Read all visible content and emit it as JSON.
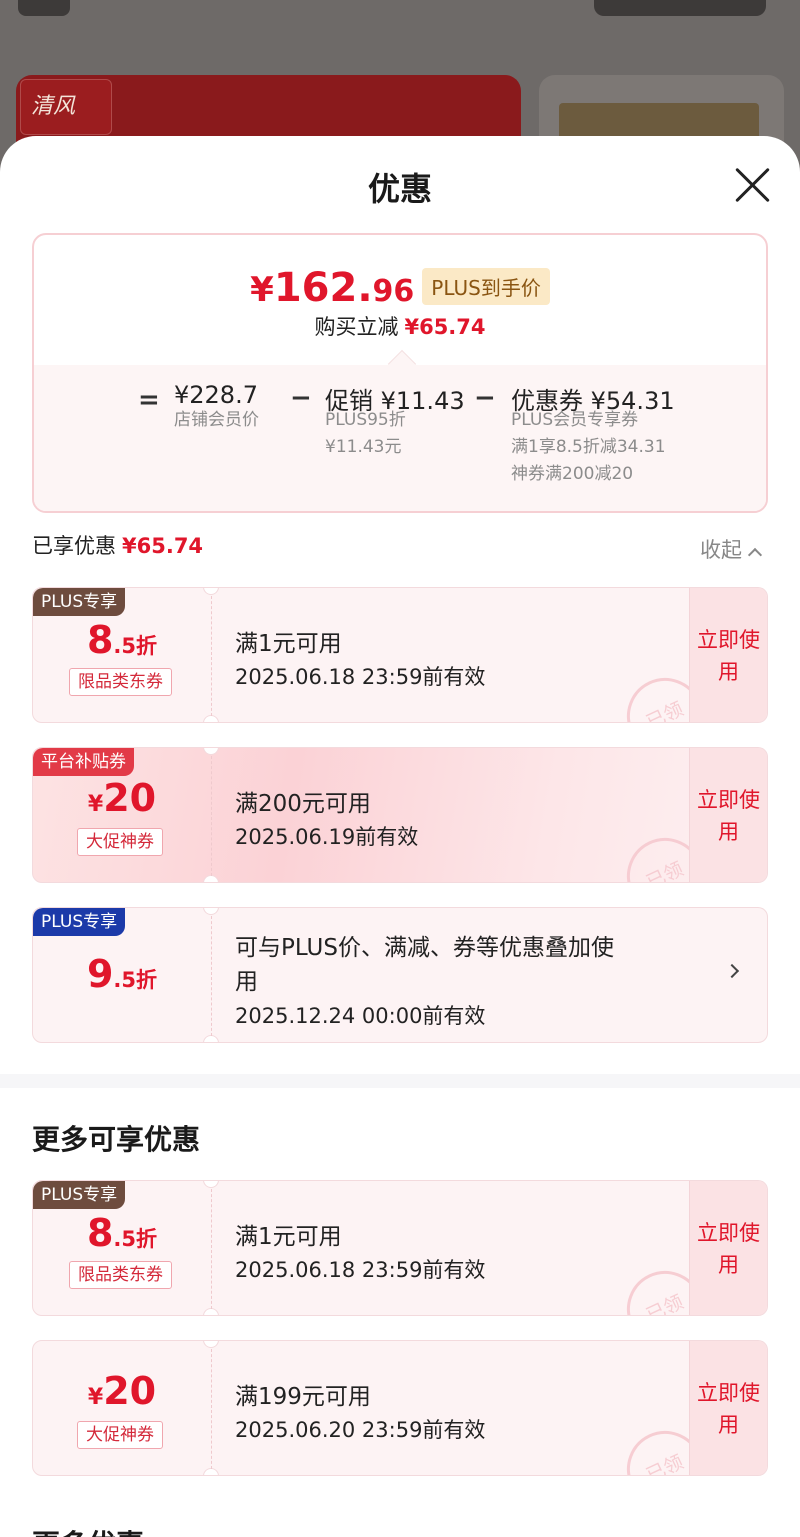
{
  "backdrop": {
    "logo_text": "清风"
  },
  "sheet": {
    "title": "优惠"
  },
  "summary": {
    "price_yen": "¥",
    "price_int": "162.",
    "price_dec": "96",
    "plus_tag": "PLUS到手价",
    "save_label": "购买立减",
    "save_value": "¥65.74",
    "eq": "=",
    "minus": "−",
    "store_price": "¥228.7",
    "store_label": "店铺会员价",
    "promo_main": "促销 ¥11.43",
    "promo_sub1": "PLUS95折",
    "promo_sub2": "¥11.43元",
    "coupon_main": "优惠券 ¥54.31",
    "coupon_sub1": "PLUS会员专享券",
    "coupon_sub2": "满1享8.5折减34.31",
    "coupon_sub3": "神券满200减20"
  },
  "enjoyed": {
    "label": "已享优惠",
    "value": "¥65.74",
    "collapse": "收起"
  },
  "coupons": [
    {
      "badge": "PLUS专享",
      "num": "8",
      "suffix": ".5折",
      "tag": "限品类东券",
      "cond": "满1元可用",
      "valid": "2025.06.18 23:59前有效",
      "btn": "立即使用",
      "stamp": "已领"
    },
    {
      "badge": "平台补贴券",
      "yen": "¥",
      "num": "20",
      "tag": "大促神券",
      "cond": "满200元可用",
      "valid": "2025.06.19前有效",
      "btn": "立即使用",
      "stamp": "已领"
    },
    {
      "badge": "PLUS专享",
      "num": "9",
      "suffix": ".5折",
      "cond1": "可与PLUS价、满减、券等优惠叠加使",
      "cond2": "用",
      "valid": "2025.12.24 00:00前有效"
    }
  ],
  "more": {
    "title": "更多可享优惠",
    "coupons": [
      {
        "badge": "PLUS专享",
        "num": "8",
        "suffix": ".5折",
        "tag": "限品类东券",
        "cond": "满1元可用",
        "valid": "2025.06.18 23:59前有效",
        "btn": "立即使用",
        "stamp": "已领"
      },
      {
        "yen": "¥",
        "num": "20",
        "tag": "大促神券",
        "cond": "满199元可用",
        "valid": "2025.06.20 23:59前有效",
        "btn": "立即使用",
        "stamp": "已领"
      }
    ],
    "next_title": "更多优惠"
  }
}
